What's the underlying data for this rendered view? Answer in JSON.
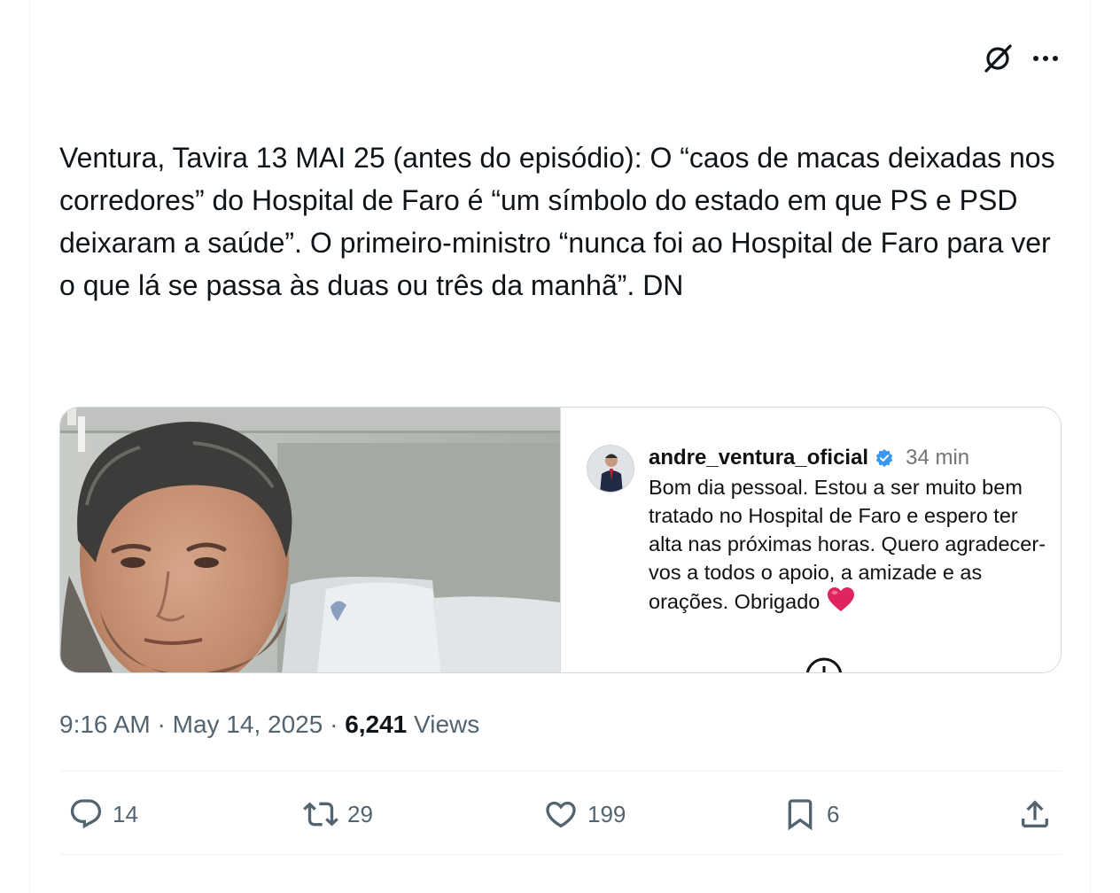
{
  "top_actions": {
    "grok_icon": "grok-icon",
    "more_icon": "more-options-icon"
  },
  "tweet": {
    "text": "Ventura, Tavira 13 MAI 25 (antes do episódio): O “caos de macas deixadas nos corredores” do Hospital de Faro é “um símbolo do estado em que PS e PSD deixaram a saúde”. O primeiro-ministro “nunca foi ao Hospital de Faro para ver o que lá se passa às duas ou três da manhã”. DN"
  },
  "media": {
    "story": {
      "username": "andre_ventura_oficial",
      "time": "34 min",
      "caption": "Bom dia pessoal. Estou a ser muito bem tratado no Hospital de Faro e espero ter alta nas próximas horas. Quero agradecer-vos a todos o apoio, a amizade e as orações. Obrigado",
      "verified_color": "#3897f0",
      "heart_color": "#e0245e"
    }
  },
  "meta": {
    "time": "9:16 AM",
    "separator": "·",
    "date": "May 14, 2025",
    "views_count": "6,241",
    "views_label": "Views"
  },
  "actions": {
    "replies": "14",
    "reposts": "29",
    "likes": "199",
    "bookmarks": "6"
  },
  "colors": {
    "text": "#0f1419",
    "secondary": "#536471",
    "border": "#eff3f4"
  }
}
